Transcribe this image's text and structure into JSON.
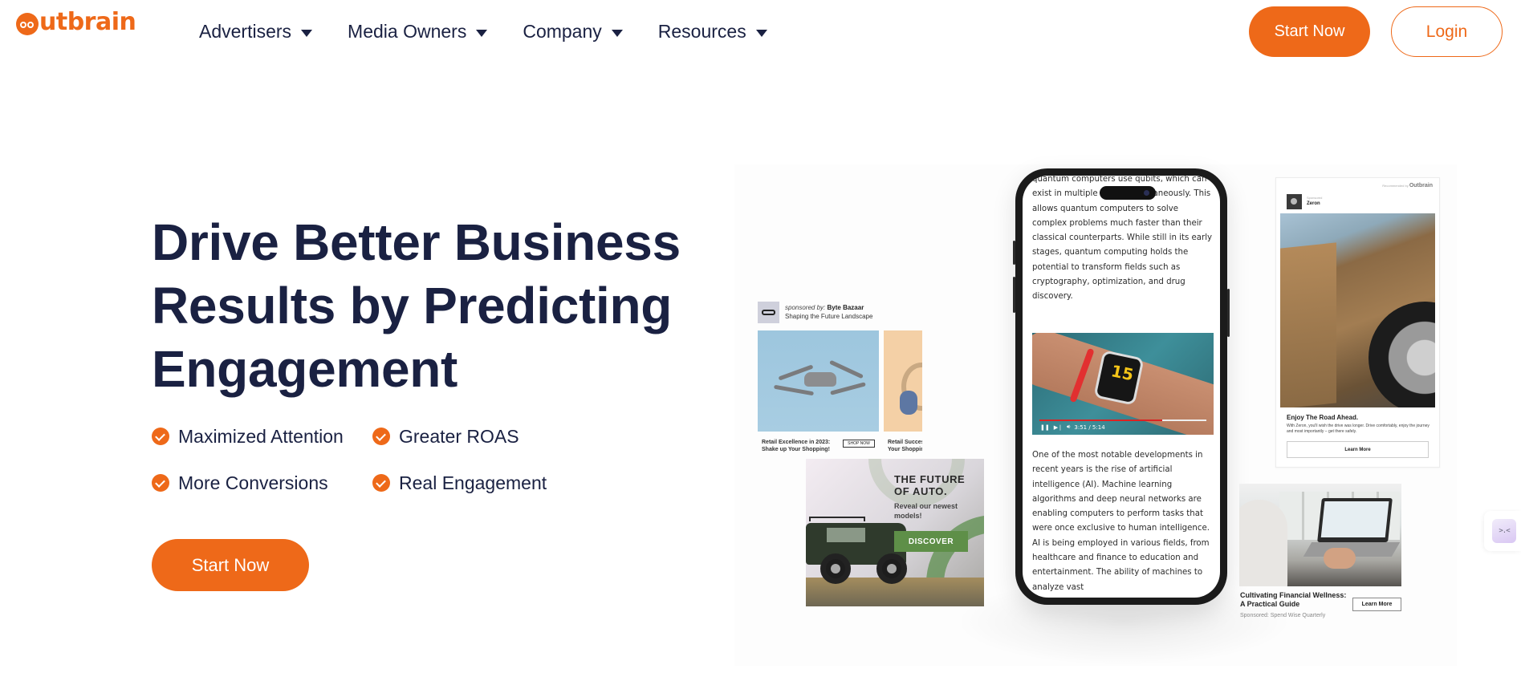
{
  "brand": {
    "name": "outbrain",
    "accent": "#ee6919",
    "text_color": "#1a2142"
  },
  "header": {
    "nav": [
      {
        "label": "Advertisers",
        "icon": "caret-down-icon"
      },
      {
        "label": "Media Owners",
        "icon": "caret-down-icon"
      },
      {
        "label": "Company",
        "icon": "caret-down-icon"
      },
      {
        "label": "Resources",
        "icon": "caret-down-icon"
      }
    ],
    "start_label": "Start Now",
    "login_label": "Login"
  },
  "hero": {
    "title": "Drive Better Business Results by Predicting Engagement",
    "benefits": [
      {
        "label": "Maximized Attention",
        "icon": "check-circle-icon"
      },
      {
        "label": "Greater ROAS",
        "icon": "check-circle-icon"
      },
      {
        "label": "More Conversions",
        "icon": "check-circle-icon"
      },
      {
        "label": "Real Engagement",
        "icon": "check-circle-icon"
      }
    ],
    "cta_label": "Start Now"
  },
  "showcase": {
    "byte_bazaar": {
      "sponsored_prefix": "sponsored by:",
      "sponsor": "Byte Bazaar",
      "tagline": "Shaping the Future Landscape",
      "caption1_line1": "Retail Excellence in 2023:",
      "caption1_line2": "Shake up Your Shopping!",
      "shop_label": "SHOP NOW",
      "caption2_line1": "Retail Success",
      "caption2_line2": "Your Shopping"
    },
    "auto_ad": {
      "headline_line1": "THE FUTURE",
      "headline_line2": "OF AUTO.",
      "sub_line1": "Reveal our newest",
      "sub_line2": "models!",
      "cta": "DISCOVER"
    },
    "phone": {
      "paragraph1": "quantum computers use qubits, which can exist in multiple states simultaneously. This allows quantum computers to solve complex problems much faster than their classical counterparts. While still in its early stages, quantum computing holds the potential to transform fields such as cryptography, optimization, and drug discovery.",
      "paragraph2": "One of the most notable developments in recent years is the rise of artificial intelligence (AI). Machine learning algorithms and deep neural networks are enabling computers to perform tasks that were once exclusive to human intelligence. AI is being employed in various fields, from healthcare and finance to education and entertainment. The ability of machines to analyze vast",
      "video": {
        "watch_number": "15",
        "time": "3:51 / 5:14",
        "progress": 0.735
      }
    },
    "zeron": {
      "recommended_by": "Recommended by",
      "recommended_brand": "Outbrain",
      "sponsored_label": "Sponsored",
      "brand": "Zeron",
      "headline": "Enjoy The Road Ahead.",
      "description": "With Zeron, you'll wish the drive was longer. Drive comfortably, enjoy the journey and most importantly – get there safely.",
      "cta": "Learn More"
    },
    "finance": {
      "headline_line1": "Cultivating Financial Wellness:",
      "headline_line2": "A Practical Guide",
      "cta": "Learn More",
      "sponsored": "Sponsored: Spend Wise Quarterly"
    }
  },
  "widget": {
    "face": ">.<",
    "icon": "chat-widget-icon"
  }
}
